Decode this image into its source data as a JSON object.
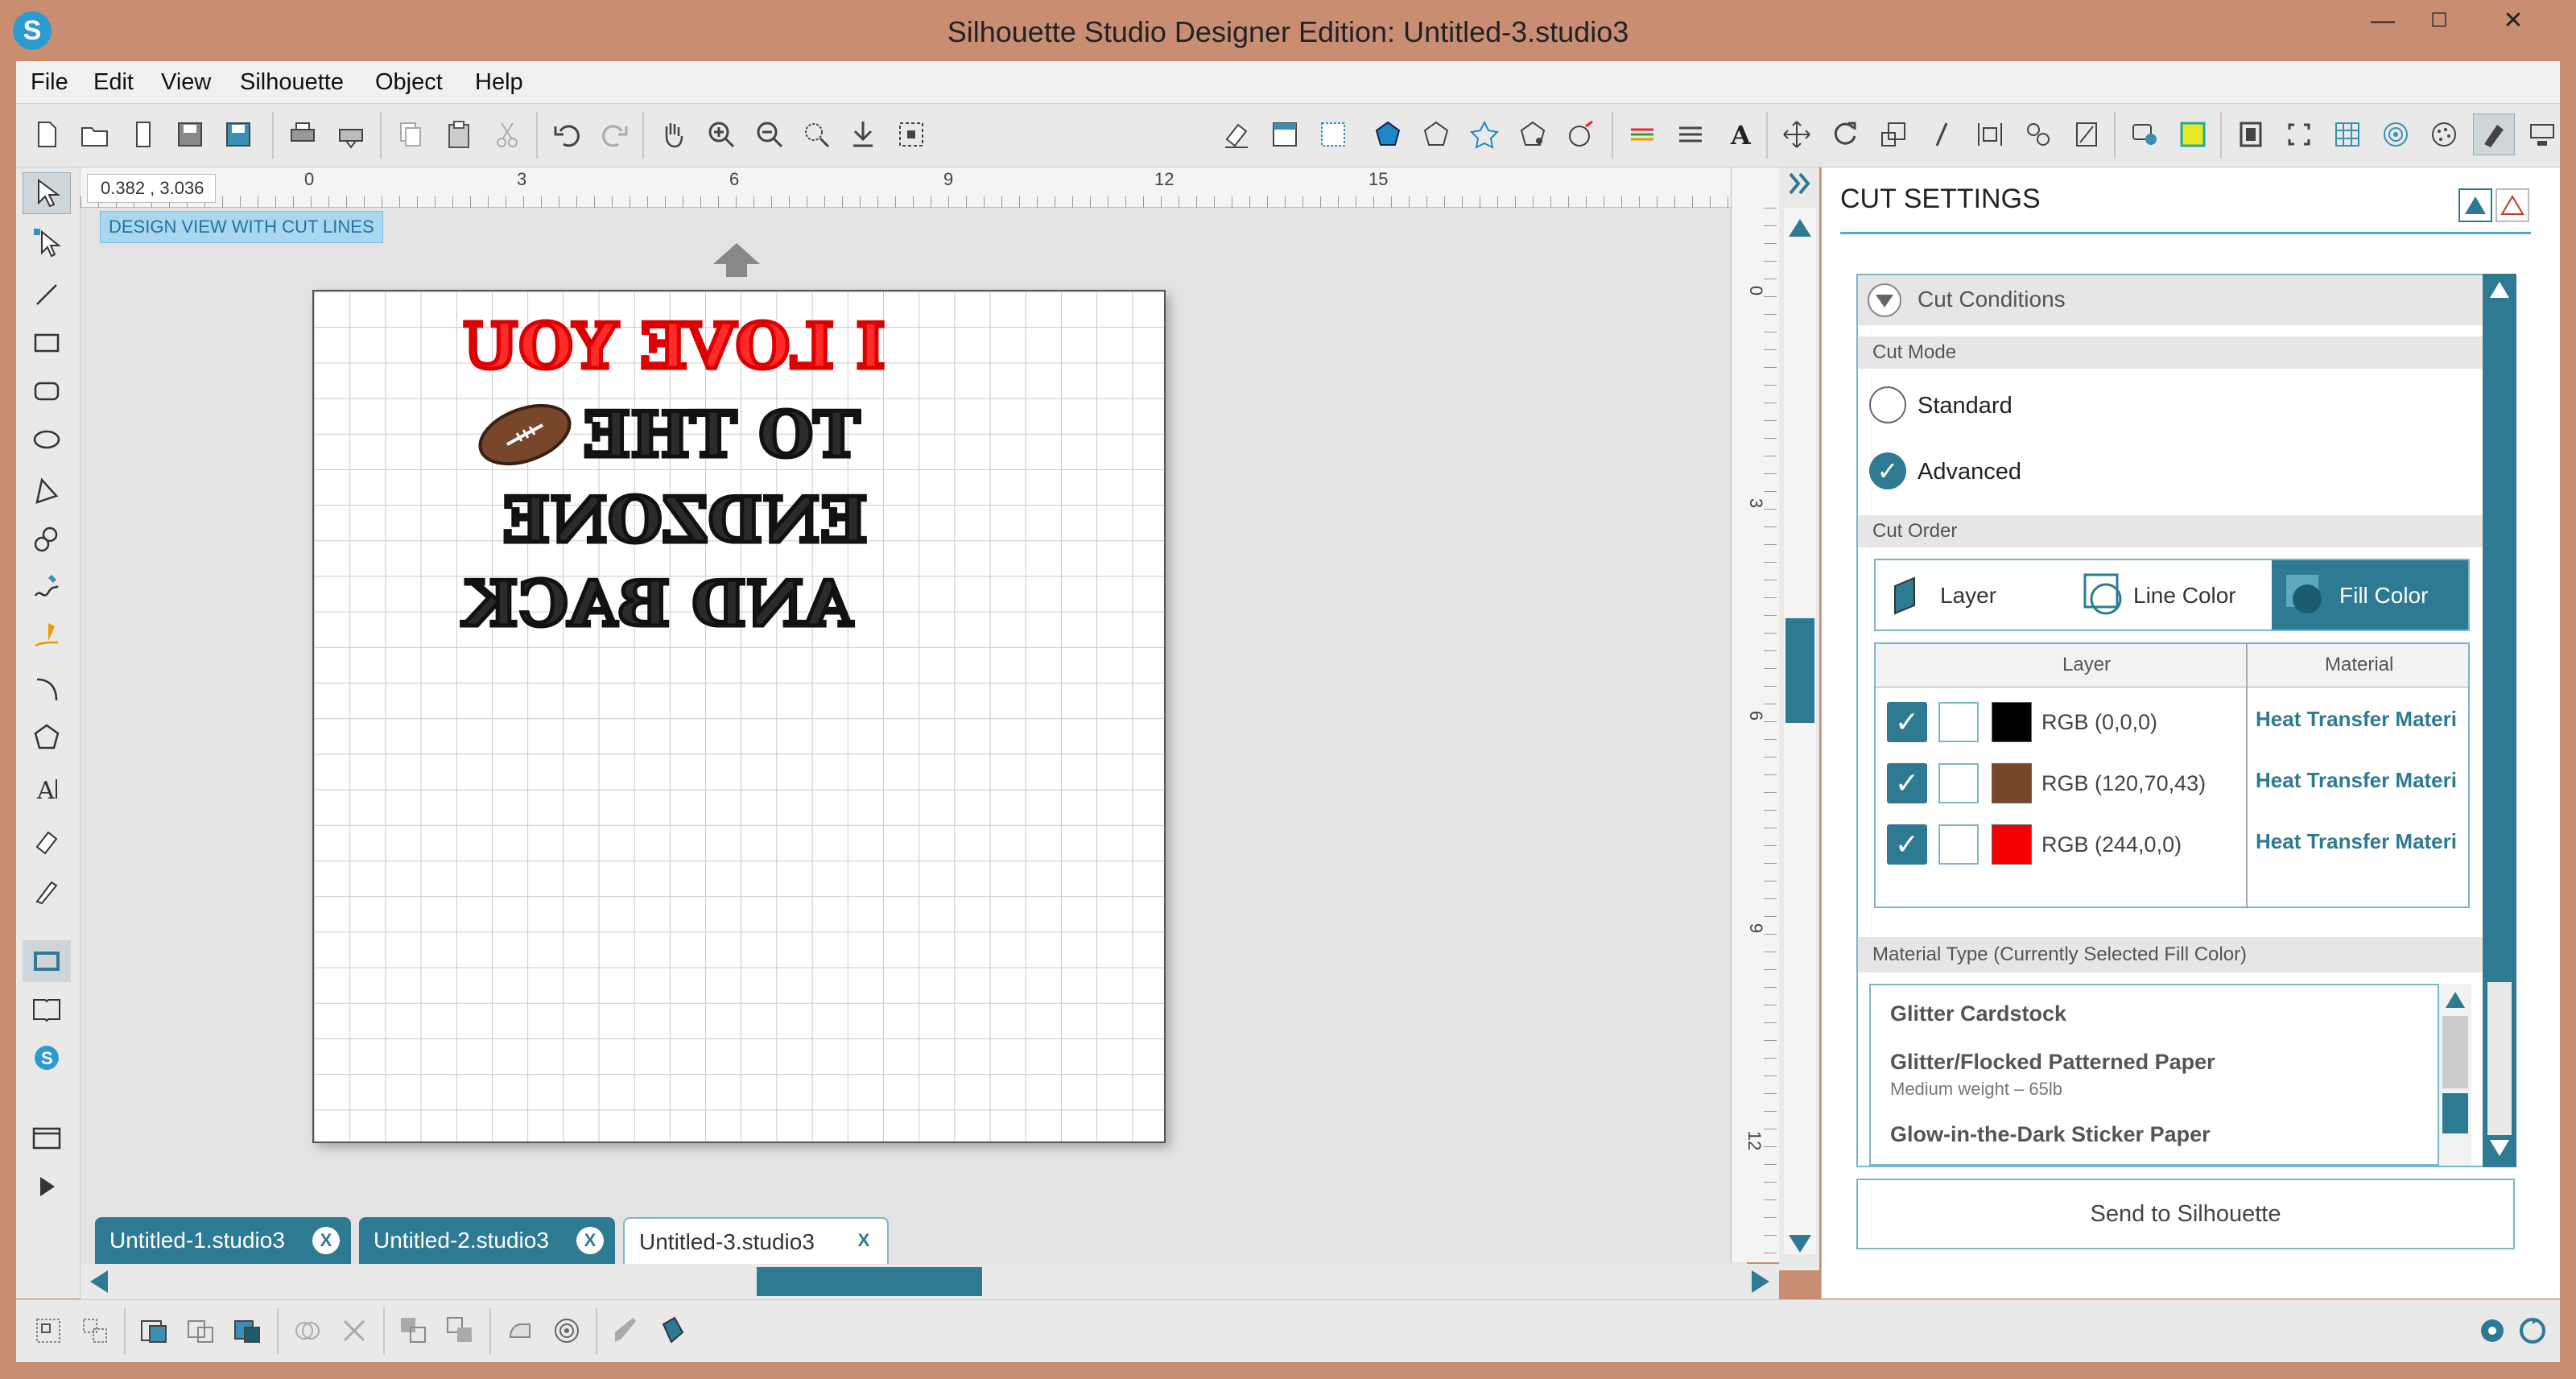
{
  "window": {
    "title": "Silhouette Studio Designer Edition: Untitled-3.studio3",
    "minimize": "—",
    "maximize": "☐",
    "close": "✕"
  },
  "menu": [
    "File",
    "Edit",
    "View",
    "Silhouette",
    "Object",
    "Help"
  ],
  "canvas": {
    "coordinates": "0.382 , 3.036",
    "view_label": "DESIGN VIEW WITH CUT LINES",
    "ruler_h": [
      "0",
      "3",
      "6",
      "9",
      "12",
      "15"
    ],
    "ruler_v": [
      "0",
      "3",
      "6",
      "9",
      "12"
    ],
    "design_lines": [
      "I LOVE YOU",
      "TO THE",
      "ENDZONE",
      "AND BACK"
    ]
  },
  "tabs": [
    {
      "label": "Untitled-1.studio3",
      "close": "X"
    },
    {
      "label": "Untitled-2.studio3",
      "close": "X"
    },
    {
      "label": "Untitled-3.studio3",
      "close": "X"
    }
  ],
  "panel": {
    "title": "CUT SETTINGS",
    "conditions_header": "Cut Conditions",
    "cut_mode_label": "Cut Mode",
    "mode_standard": "Standard",
    "mode_advanced": "Advanced",
    "cut_order_label": "Cut Order",
    "order_layer": "Layer",
    "order_line_color": "Line Color",
    "order_fill_color": "Fill Color",
    "table_headers": {
      "layer": "Layer",
      "material": "Material"
    },
    "rows": [
      {
        "color_label": "RGB (0,0,0)",
        "swatch": "#000000",
        "material": "Heat Transfer Materi"
      },
      {
        "color_label": "RGB (120,70,43)",
        "swatch": "#78462b",
        "material": "Heat Transfer Materi"
      },
      {
        "color_label": "RGB (244,0,0)",
        "swatch": "#f40000",
        "material": "Heat Transfer Materi"
      }
    ],
    "material_type_label": "Material Type (Currently Selected Fill Color)",
    "materials": [
      {
        "name": "Glitter Cardstock",
        "sub": ""
      },
      {
        "name": "Glitter/Flocked Patterned Paper",
        "sub": "Medium weight – 65lb"
      },
      {
        "name": "Glow-in-the-Dark Sticker Paper",
        "sub": ""
      }
    ],
    "send_button": "Send to Silhouette"
  },
  "colors": {
    "accent": "#2e7a93",
    "title_bar": "#c98e72",
    "selected_tab": "#ffffff",
    "inactive_tab": "#2e7a93"
  }
}
